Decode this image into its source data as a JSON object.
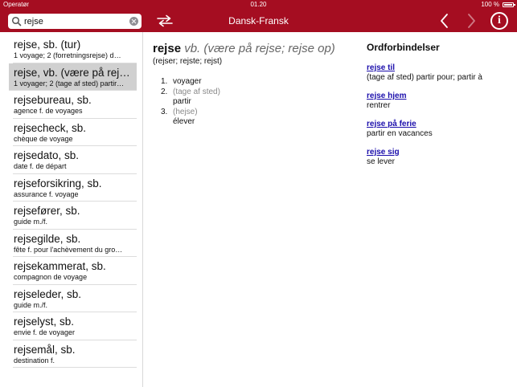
{
  "status": {
    "carrier": "Operatør",
    "time": "01.20",
    "battery": "100 %"
  },
  "search": {
    "value": "rejse",
    "placeholder": ""
  },
  "header": {
    "title": "Dansk-Fransk"
  },
  "list": [
    {
      "headword": "rejse, sb. (tur)",
      "translation": "1 voyage; 2 (forretningsrejse) d…"
    },
    {
      "headword": "rejse, vb. (være på rej…",
      "translation": "1 voyager; 2 (tage af sted) partir…"
    },
    {
      "headword": "rejsebureau, sb.",
      "translation": "agence f. de voyages"
    },
    {
      "headword": "rejsecheck, sb.",
      "translation": "chèque de voyage"
    },
    {
      "headword": "rejsedato, sb.",
      "translation": "date f. de départ"
    },
    {
      "headword": "rejseforsikring, sb.",
      "translation": "assurance f. voyage"
    },
    {
      "headword": "rejsefører, sb.",
      "translation": "guide m./f."
    },
    {
      "headword": "rejsegilde, sb.",
      "translation": "fête f. pour l'achèvement du gro…"
    },
    {
      "headword": "rejsekammerat, sb.",
      "translation": "compagnon de voyage"
    },
    {
      "headword": "rejseleder, sb.",
      "translation": "guide m./f."
    },
    {
      "headword": "rejselyst, sb.",
      "translation": "envie f. de voyager"
    },
    {
      "headword": "rejsemål, sb.",
      "translation": "destination f."
    }
  ],
  "entry": {
    "word": "rejse",
    "pos": "vb. (være på rejse; rejse op)",
    "forms": "(rejser; rejste; rejst)",
    "senses": [
      {
        "num": "1.",
        "note": "",
        "text": "voyager"
      },
      {
        "num": "2.",
        "note": "(tage af sted)",
        "text": "partir"
      },
      {
        "num": "3.",
        "note": "(hejse)",
        "text": "élever"
      }
    ]
  },
  "phrases": {
    "title": "Ordforbindelser",
    "items": [
      {
        "phrase": "rejse til",
        "translation": "(tage af sted) partir pour; partir à"
      },
      {
        "phrase": "rejse hjem",
        "translation": "rentrer"
      },
      {
        "phrase": "rejse på ferie",
        "translation": "partir en vacances"
      },
      {
        "phrase": "rejse sig",
        "translation": "se lever"
      }
    ]
  },
  "colors": {
    "topbar": "#a50d21",
    "link": "#1a0dab",
    "selected": "#d0d0d0"
  }
}
